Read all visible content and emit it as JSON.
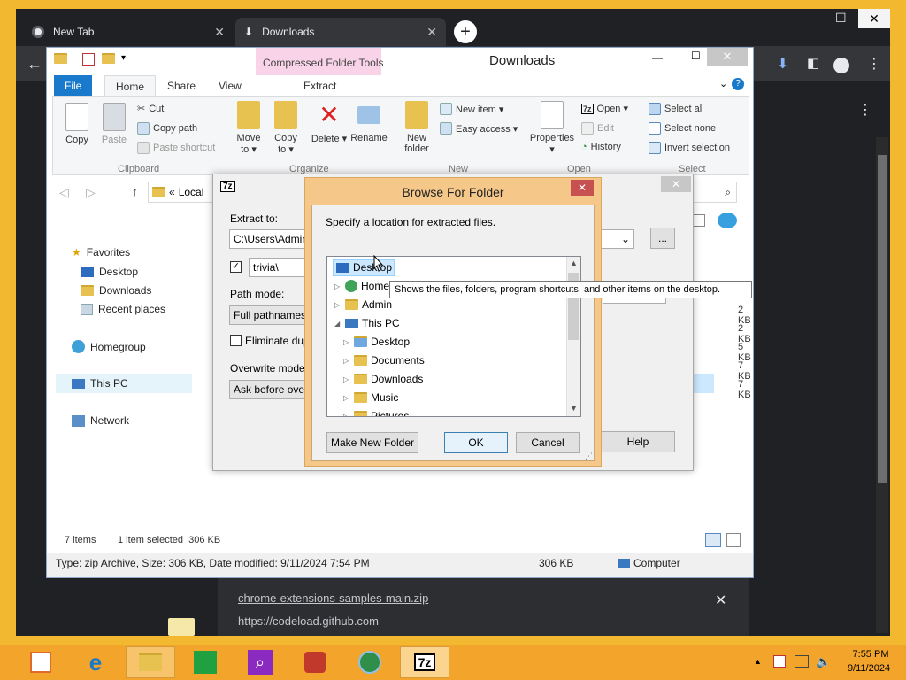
{
  "chrome": {
    "tabs": [
      {
        "label": "New Tab",
        "active": false
      },
      {
        "label": "Downloads",
        "active": true
      }
    ],
    "download": {
      "filename": "chrome-extensions-samples-main.zip",
      "source": "https://codeload.github.com"
    }
  },
  "explorer": {
    "title": "Downloads",
    "contextual_tab": "Compressed Folder Tools",
    "ribbon_tabs": [
      "File",
      "Home",
      "Share",
      "View",
      "Extract"
    ],
    "ribbon": {
      "copy": "Copy",
      "paste": "Paste",
      "cut": "Cut",
      "copy_path": "Copy path",
      "paste_shortcut": "Paste shortcut",
      "move_to": "Move to ▾",
      "copy_to": "Copy to ▾",
      "delete": "Delete ▾",
      "rename": "Rename",
      "new_folder": "New folder",
      "new_item": "New item ▾",
      "easy_access": "Easy access ▾",
      "properties": "Properties ▾",
      "open": "Open ▾",
      "edit": "Edit",
      "history": "History",
      "select_all": "Select all",
      "select_none": "Select none",
      "invert_selection": "Invert selection",
      "groups": [
        "Clipboard",
        "Organize",
        "New",
        "Open",
        "Select"
      ]
    },
    "address": "Local",
    "address_prefix": "«",
    "nav": {
      "favorites": "Favorites",
      "desktop": "Desktop",
      "downloads": "Downloads",
      "recent": "Recent places",
      "homegroup": "Homegroup",
      "thispc": "This PC",
      "network": "Network"
    },
    "sizes": [
      "2 KB",
      "2 KB",
      "5 KB",
      "7 KB",
      "7 KB"
    ],
    "status_items": "7 items",
    "status_selected": "1 item selected  306 KB",
    "details": "Type: zip Archive, Size: 306 KB, Date modified: 9/11/2024 7:54 PM",
    "details_size": "306 KB",
    "details_location": "Computer"
  },
  "sevenzip": {
    "title_icon": "7z",
    "extract_to_label": "Extract to:",
    "extract_to_value": "C:\\Users\\Admin\\",
    "browse_button": "...",
    "subfolder_value": "trivia\\",
    "path_mode_label": "Path mode:",
    "path_mode_value": "Full pathnames",
    "eliminate_label": "Eliminate dupli",
    "overwrite_label": "Overwrite mode:",
    "overwrite_value": "Ask before overw",
    "help": "Help"
  },
  "browse": {
    "title": "Browse For Folder",
    "instruction": "Specify a location for extracted files.",
    "tree": {
      "desktop": "Desktop",
      "home": "Home",
      "admin": "Admin",
      "thispc": "This PC",
      "pc_desktop": "Desktop",
      "documents": "Documents",
      "downloads": "Downloads",
      "music": "Music",
      "pictures": "Pictures"
    },
    "tooltip": "Shows the files, folders, program shortcuts, and other items on the desktop.",
    "make_new_folder": "Make New Folder",
    "ok": "OK",
    "cancel": "Cancel"
  },
  "taskbar": {
    "time": "7:55 PM",
    "date": "9/11/2024",
    "sevenzip_label": "7z"
  }
}
